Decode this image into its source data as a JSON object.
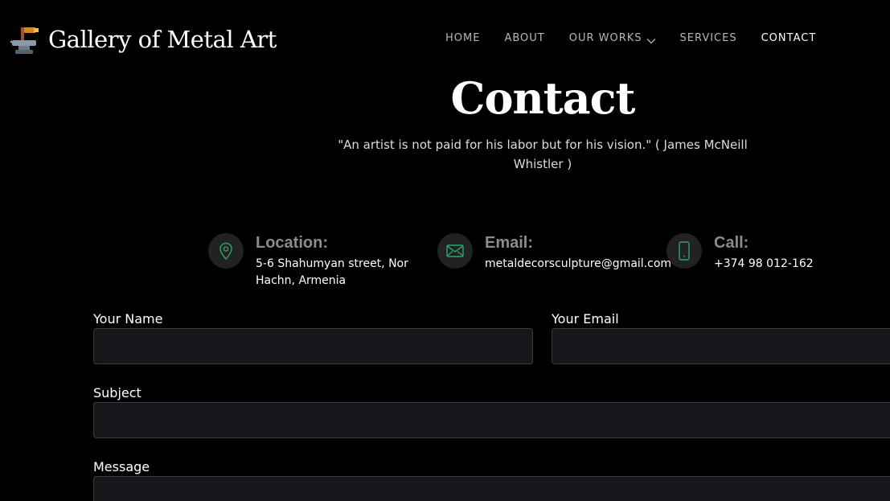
{
  "site": {
    "name": "Gallery of Metal Art",
    "logo_icon": "anvil-hammer-icon"
  },
  "nav": {
    "items": [
      {
        "label": "HOME"
      },
      {
        "label": "ABOUT"
      },
      {
        "label": "OUR WORKS"
      },
      {
        "label": "SERVICES"
      },
      {
        "label": "CONTACT"
      }
    ],
    "active": "CONTACT"
  },
  "page": {
    "title": "Contact",
    "quote": "\"An artist is not paid for his labor but for his vision.\" ( James McNeill Whistler )"
  },
  "info": {
    "location": {
      "title": "Location:",
      "text": "5-6 Shahumyan street, Nor Hachn, Armenia",
      "icon": "map-pin-icon"
    },
    "email": {
      "title": "Email:",
      "text": "metaldecorsculpture@gmail.com",
      "icon": "envelope-icon"
    },
    "call": {
      "title": "Call:",
      "text": "+374 98 012-162",
      "icon": "phone-icon"
    }
  },
  "form": {
    "name_label": "Your Name",
    "email_label": "Your Email",
    "subject_label": "Subject",
    "message_label": "Message"
  },
  "colors": {
    "background": "#000000",
    "accent": "#2fa36b",
    "input_bg": "#16171a"
  }
}
